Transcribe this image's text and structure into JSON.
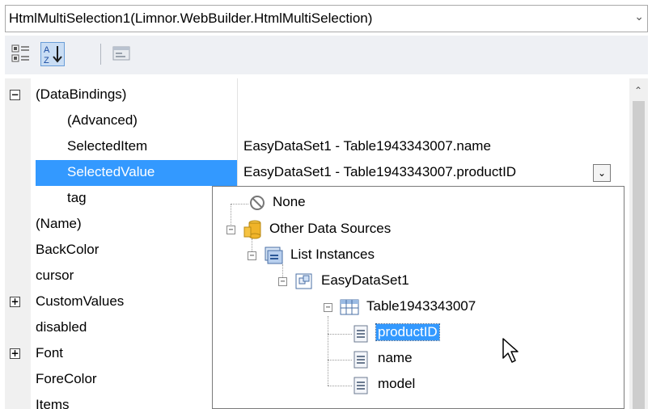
{
  "object_selector": {
    "text": "HtmlMultiSelection1(Limnor.WebBuilder.HtmlMultiSelection)"
  },
  "toolbar": {
    "buttons": [
      "categorized-icon",
      "alphabetical-icon",
      "property-pages-icon"
    ]
  },
  "properties": [
    {
      "name": "(DataBindings)",
      "expander": "−",
      "value": ""
    },
    {
      "name": "(Advanced)",
      "value": ""
    },
    {
      "name": "SelectedItem",
      "value": "EasyDataSet1 - Table1943343007.name"
    },
    {
      "name": "SelectedValue",
      "value": "EasyDataSet1 - Table1943343007.productID"
    },
    {
      "name": "tag",
      "value": ""
    },
    {
      "name": "(Name)",
      "value": ""
    },
    {
      "name": "BackColor",
      "value": ""
    },
    {
      "name": "cursor",
      "value": ""
    },
    {
      "name": "CustomValues",
      "expander": "+",
      "value": ""
    },
    {
      "name": "disabled",
      "value": ""
    },
    {
      "name": "Font",
      "expander": "+",
      "value": ""
    },
    {
      "name": "ForeColor",
      "value": ""
    },
    {
      "name": "Items",
      "value": ""
    }
  ],
  "tree": {
    "none": "None",
    "other_sources": "Other Data Sources",
    "list_instances": "List Instances",
    "dataset": "EasyDataSet1",
    "table": "Table1943343007",
    "fields": [
      "productID",
      "name",
      "model"
    ]
  },
  "colors": {
    "selection": "#3399ff"
  }
}
